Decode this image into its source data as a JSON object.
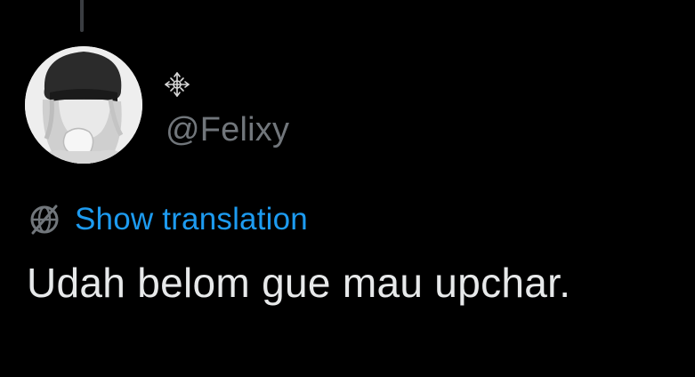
{
  "post": {
    "handle": "@Felixy",
    "display_name_icon": "ornate-star-glyph-icon",
    "avatar_icon": "profile-avatar-beanie",
    "translation_label": "Show translation",
    "translation_icon": "globe-slash-icon",
    "text": "Udah belom gue mau upchar."
  },
  "colors": {
    "background": "#000000",
    "text_primary": "#e7e9ea",
    "text_secondary": "#71767b",
    "link": "#1d9bf0",
    "thread_line": "#3a3d41"
  }
}
